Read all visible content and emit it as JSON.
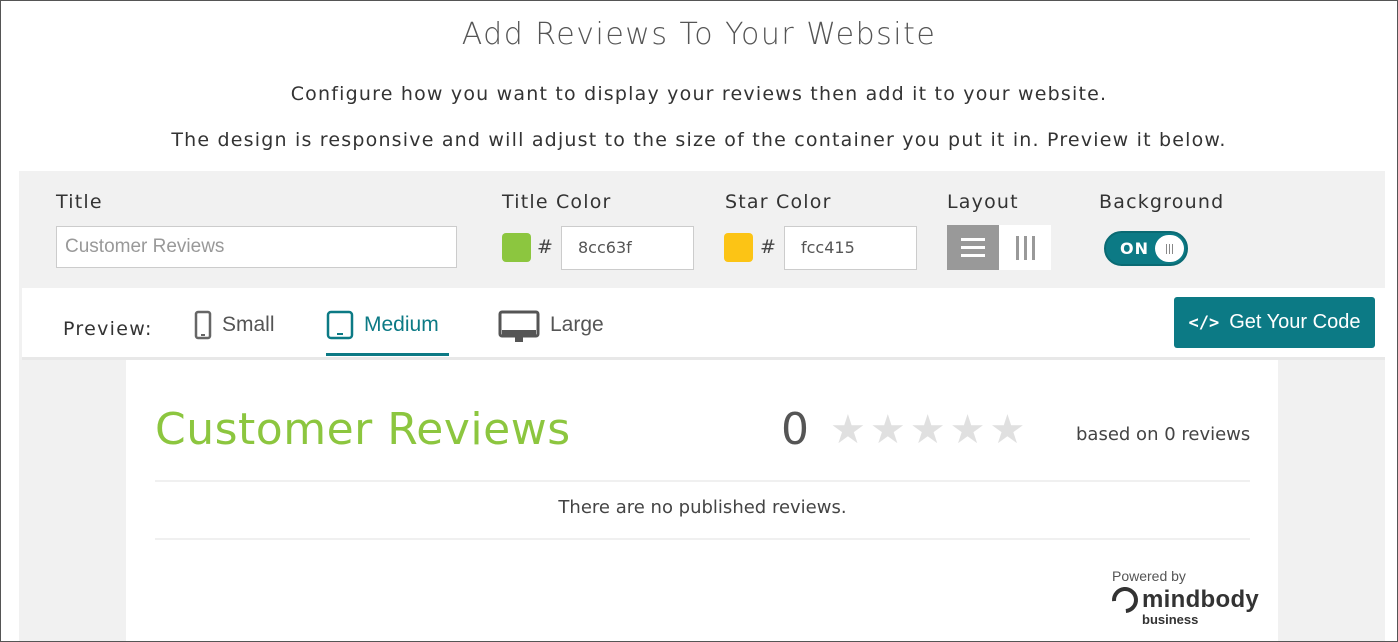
{
  "header": {
    "title": "Add Reviews To Your Website",
    "subtitle_1": "Configure how you want to display your reviews then add it to your website.",
    "subtitle_2": "The design is responsive and will adjust to the size of the container you put it in. Preview it below."
  },
  "config": {
    "title_label": "Title",
    "title_placeholder": "Customer Reviews",
    "title_color_label": "Title Color",
    "title_color_value": "8cc63f",
    "title_color_hex": "#8cc63f",
    "star_color_label": "Star Color",
    "star_color_value": "fcc415",
    "star_color_hex": "#fcc415",
    "hash_symbol": "#",
    "layout_label": "Layout",
    "layout_options": [
      "list-layout-icon",
      "columns-layout-icon"
    ],
    "layout_selected": "list",
    "background_label": "Background",
    "background_toggle": "ON"
  },
  "preview": {
    "label": "Preview:",
    "tabs": [
      {
        "label": "Small",
        "icon": "phone-icon"
      },
      {
        "label": "Medium",
        "icon": "tablet-icon"
      },
      {
        "label": "Large",
        "icon": "desktop-icon"
      }
    ],
    "active_tab": "Medium",
    "code_button_icon": "</>",
    "code_button_label": "Get Your Code"
  },
  "widget": {
    "title": "Customer Reviews",
    "score": "0",
    "star_count": 5,
    "rating": 0,
    "based_on": "based on 0 reviews",
    "empty_message": "There are no published reviews.",
    "powered_by": "Powered by",
    "brand_name": "mindbody",
    "brand_sub": "business"
  },
  "colors": {
    "accent": "#0c7a85",
    "title_green": "#8cc63f",
    "star_yellow": "#fcc415",
    "empty_star": "#e0e0e0"
  }
}
